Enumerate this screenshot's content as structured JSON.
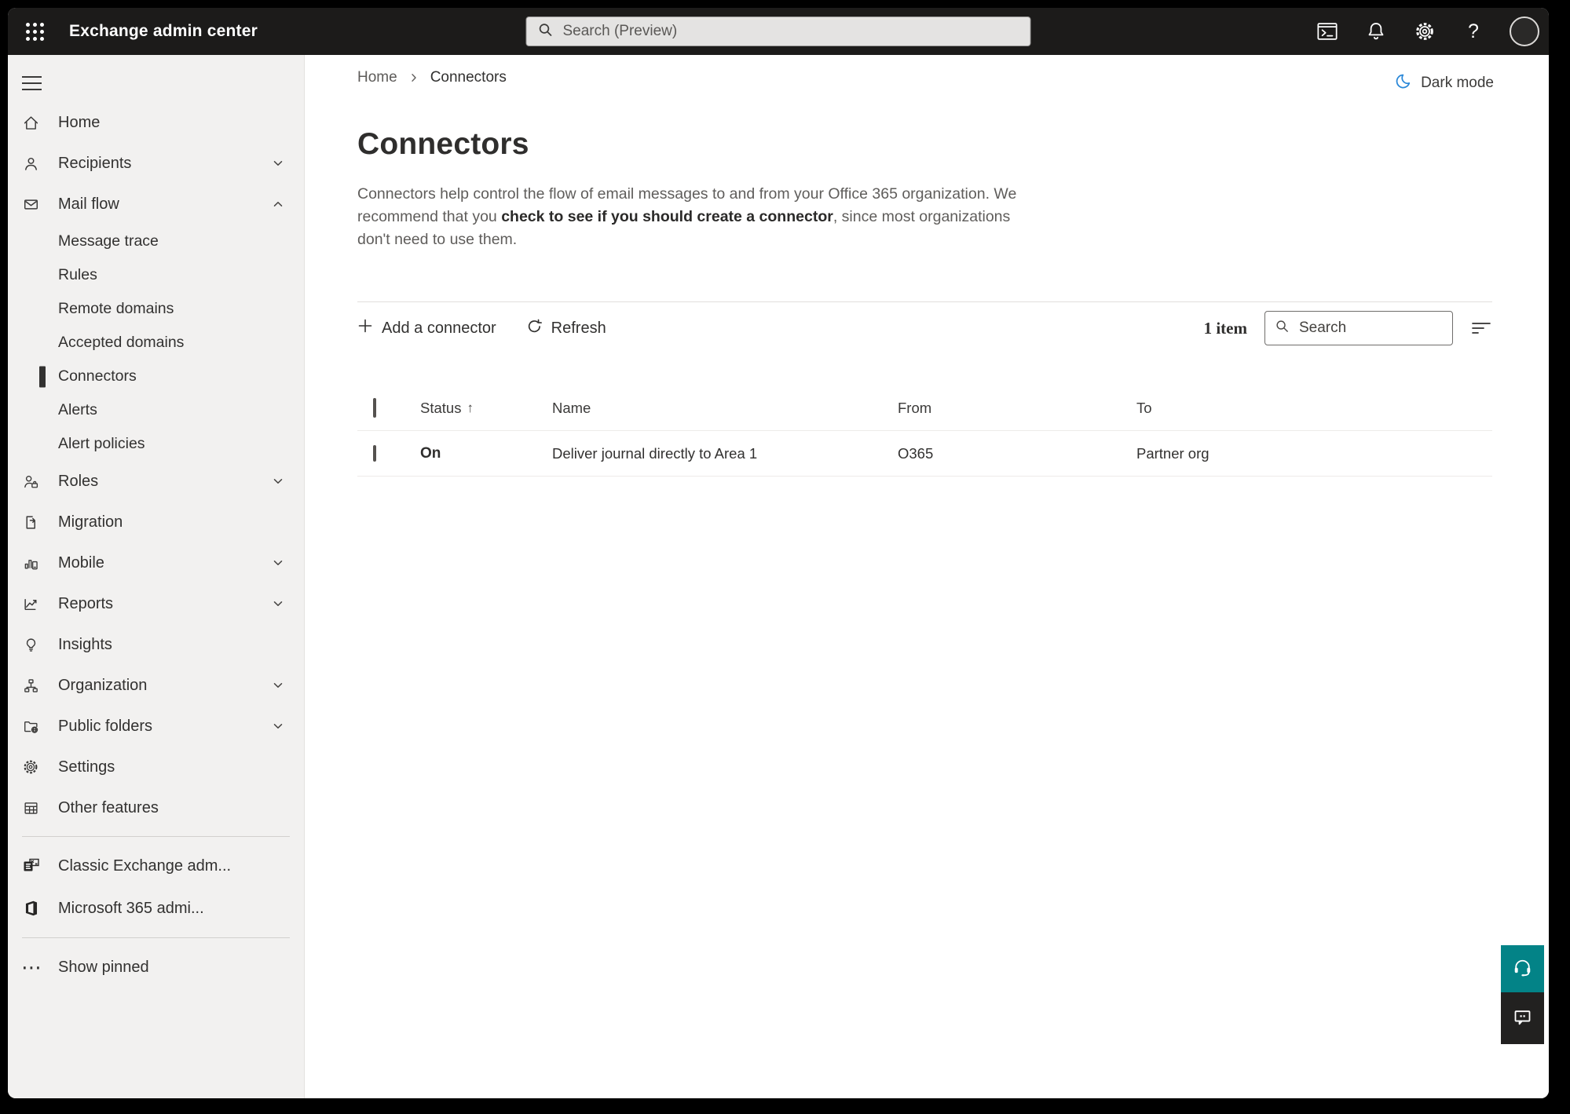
{
  "topbar": {
    "app_title": "Exchange admin center",
    "search_placeholder": "Search (Preview)"
  },
  "sidebar": {
    "items": [
      {
        "label": "Home"
      },
      {
        "label": "Recipients",
        "chevron": "down"
      },
      {
        "label": "Mail flow",
        "chevron": "up",
        "expanded": true
      },
      {
        "label": "Message trace",
        "type": "sub"
      },
      {
        "label": "Rules",
        "type": "sub"
      },
      {
        "label": "Remote domains",
        "type": "sub"
      },
      {
        "label": "Accepted domains",
        "type": "sub"
      },
      {
        "label": "Connectors",
        "type": "sub",
        "selected": true
      },
      {
        "label": "Alerts",
        "type": "sub"
      },
      {
        "label": "Alert policies",
        "type": "sub"
      },
      {
        "label": "Roles",
        "chevron": "down"
      },
      {
        "label": "Migration"
      },
      {
        "label": "Mobile",
        "chevron": "down"
      },
      {
        "label": "Reports",
        "chevron": "down"
      },
      {
        "label": "Insights"
      },
      {
        "label": "Organization",
        "chevron": "down"
      },
      {
        "label": "Public folders",
        "chevron": "down"
      },
      {
        "label": "Settings"
      },
      {
        "label": "Other features"
      }
    ],
    "pinned": [
      {
        "label": "Classic Exchange adm..."
      },
      {
        "label": "Microsoft 365 admi..."
      }
    ],
    "show_pinned_label": "Show pinned"
  },
  "breadcrumb": {
    "home": "Home",
    "current": "Connectors"
  },
  "theme_toggle": {
    "label": "Dark mode"
  },
  "page": {
    "title": "Connectors",
    "description_1": "Connectors help control the flow of email messages to and from your Office 365 organization. We recommend that you ",
    "description_link": "check to see if you should create a connector",
    "description_2": ", since most organizations don't need to use them."
  },
  "toolbar": {
    "add_label": "Add a connector",
    "refresh_label": "Refresh",
    "item_count": "1 item",
    "search_placeholder": "Search"
  },
  "table": {
    "columns": {
      "status": "Status",
      "name": "Name",
      "from": "From",
      "to": "To"
    },
    "sort": {
      "column": "Status",
      "direction": "ascending",
      "arrow_glyph": "↑"
    },
    "rows": [
      {
        "status": "On",
        "name": "Deliver journal directly to Area 1",
        "from": "O365",
        "to": "Partner org"
      }
    ]
  },
  "icons": {
    "help_glyph": "?",
    "ellipsis_glyph": "⋯",
    "gear_glyph": "⚙"
  },
  "colors": {
    "topbar_bg": "#1c1b1a",
    "sidebar_bg": "#f2f1f0",
    "accent_teal": "#038387",
    "feedback_dark": "#222120",
    "moon_blue": "#2b88d8",
    "text_primary": "#323130",
    "text_secondary": "#5f5d5b",
    "selected_indicator": "#323130"
  }
}
